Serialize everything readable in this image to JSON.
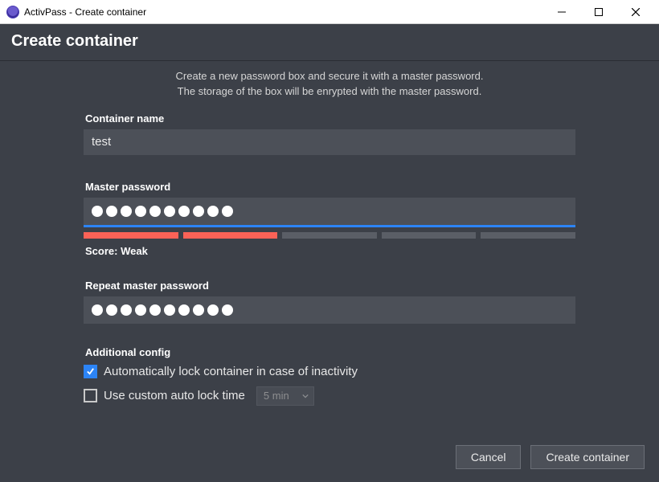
{
  "window": {
    "title": "ActivPass - Create container"
  },
  "header": {
    "title": "Create container"
  },
  "intro": {
    "line1": "Create a new password box and secure it with a master password.",
    "line2": "The storage of the box will be enrypted with the master password."
  },
  "form": {
    "container_name_label": "Container name",
    "container_name_value": "test",
    "master_password_label": "Master password",
    "master_password_length": 10,
    "strength": {
      "segments": 5,
      "filled": 2,
      "score_prefix": "Score: ",
      "score_value": "Weak"
    },
    "repeat_label": "Repeat master password",
    "repeat_password_length": 10
  },
  "additional": {
    "section_label": "Additional config",
    "auto_lock": {
      "checked": true,
      "label": "Automatically lock container in case of inactivity"
    },
    "custom_time": {
      "checked": false,
      "label": "Use custom auto lock time",
      "select_value": "5 min",
      "select_disabled": true
    }
  },
  "buttons": {
    "cancel": "Cancel",
    "create": "Create container"
  }
}
